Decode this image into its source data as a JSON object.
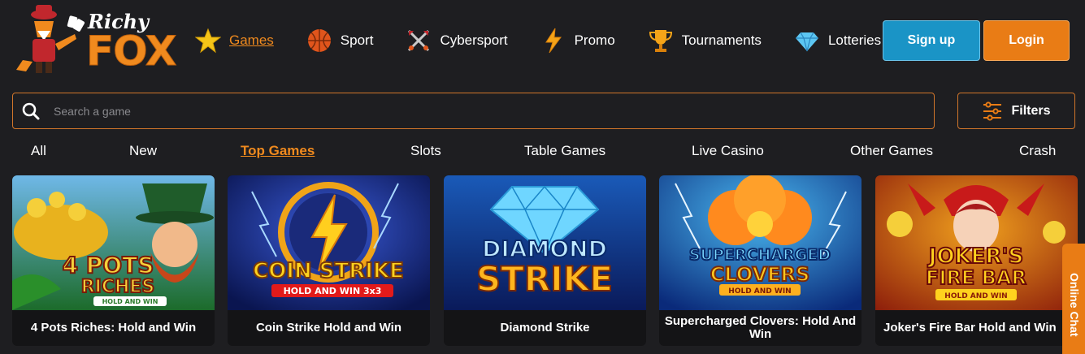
{
  "brand": {
    "line1": "Richy",
    "line2": "FOX"
  },
  "nav": [
    {
      "label": "Games",
      "icon": "star-icon",
      "active": true
    },
    {
      "label": "Sport",
      "icon": "basketball-icon"
    },
    {
      "label": "Cybersport",
      "icon": "crossed-swords-icon"
    },
    {
      "label": "Promo",
      "icon": "lightning-icon"
    },
    {
      "label": "Tournaments",
      "icon": "trophy-icon"
    },
    {
      "label": "Lotteries",
      "icon": "diamond-icon"
    }
  ],
  "auth": {
    "signup": "Sign up",
    "login": "Login"
  },
  "search": {
    "placeholder": "Search a game"
  },
  "filters": {
    "label": "Filters"
  },
  "categories": [
    "All",
    "New",
    "Top Games",
    "Slots",
    "Table Games",
    "Live Casino",
    "Other Games",
    "Crash"
  ],
  "active_category": "Top Games",
  "games": [
    {
      "title": "4 Pots Riches: Hold and Win",
      "art_text": [
        "4 POTS",
        "RICHES",
        "HOLD AND WIN"
      ]
    },
    {
      "title": "Coin Strike Hold and Win",
      "art_text": [
        "COIN STRIKE",
        "HOLD AND WIN 3x3"
      ]
    },
    {
      "title": "Diamond Strike",
      "art_text": [
        "DIAMOND",
        "STRIKE"
      ]
    },
    {
      "title": "Supercharged Clovers: Hold And Win",
      "art_text": [
        "SUPERCHARGED",
        "CLOVERS",
        "HOLD AND WIN"
      ]
    },
    {
      "title": "Joker's Fire Bar Hold and Win",
      "art_text": [
        "JOKER'S",
        "FIRE BAR",
        "HOLD AND WIN"
      ]
    }
  ],
  "chat": {
    "label": "Online Chat"
  },
  "colors": {
    "accent": "#e97c15",
    "signup": "#1a94c6",
    "background": "#1e1e21"
  }
}
